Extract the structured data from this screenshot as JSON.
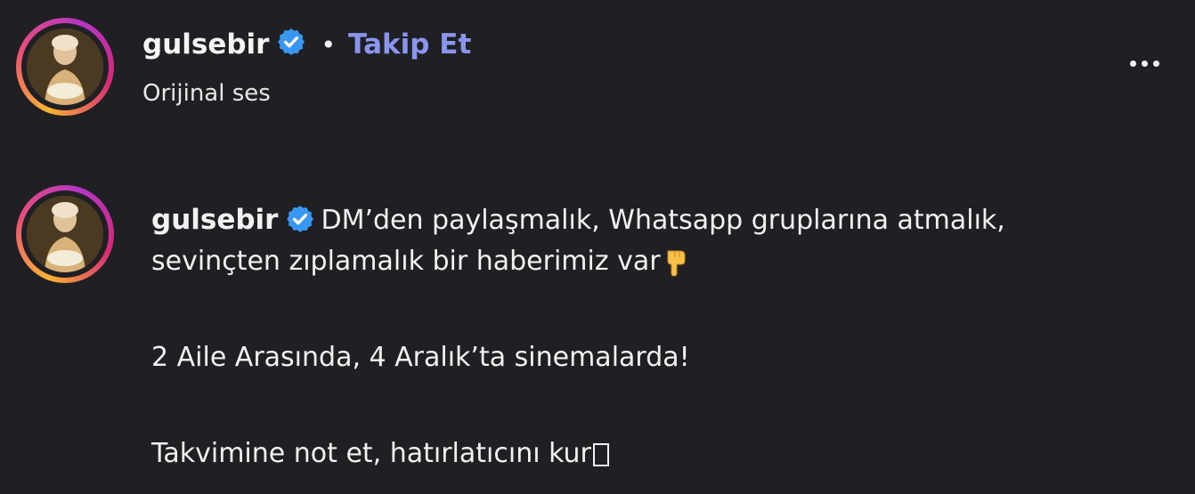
{
  "post": {
    "username": "gulsebir",
    "separator": "•",
    "follow_label": "Takip Et",
    "audio_label": "Orijinal ses",
    "more_icon": "more-horizontal-icon"
  },
  "comment": {
    "username": "gulsebir",
    "line1": "DM’den paylaşmalık, Whatsapp gruplarına atmalık,",
    "line2": "sevinçten zıplamalık bir haberimiz var",
    "line3": "2 Aile Arasında, 4 Aralık’ta sinemalarda!",
    "line4": "Takvimine not et, hatırlatıcını kur"
  },
  "colors": {
    "background": "#1f1f24",
    "follow": "#8a96ee",
    "verified": "#3897f0"
  }
}
